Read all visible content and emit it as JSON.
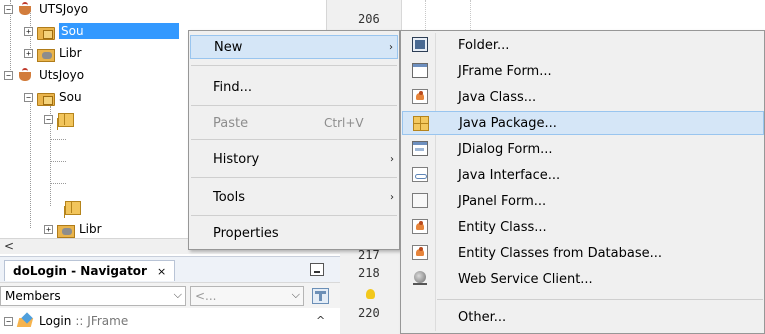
{
  "project_tree": {
    "nodes": [
      {
        "label": "UTSJoyo",
        "icon": "project-cup-icon"
      },
      {
        "label": "Sou",
        "icon": "source-packages-icon",
        "selected": true
      },
      {
        "label": "Libr",
        "icon": "libraries-icon"
      },
      {
        "label": "UtsJoyo",
        "icon": "project-cup-icon"
      },
      {
        "label": "Sou",
        "icon": "source-packages-icon"
      },
      {
        "label": "",
        "icon": "package-icon"
      },
      {
        "label": "",
        "icon": "package-icon"
      },
      {
        "label": "Libr",
        "icon": "libraries-icon"
      }
    ],
    "expander_collapsed": "+",
    "expander_expanded": "−",
    "scroll_left_arrow": "<"
  },
  "editor": {
    "line_numbers": [
      "206",
      "217",
      "218",
      "220"
    ]
  },
  "navigator": {
    "tab_title": "doLogin - Navigator",
    "tab_close": "×",
    "members_label": "Members",
    "filter_placeholder": "<...",
    "dropdown_glyph": "⌵",
    "root_name": "Login",
    "root_type": ":: JFrame",
    "scroll_up_arrow": "^"
  },
  "context_menu": {
    "items": [
      {
        "label": "New",
        "submenu": true,
        "highlighted": true
      },
      {
        "label": "Find..."
      },
      {
        "label": "Paste",
        "shortcut": "Ctrl+V",
        "disabled": true
      },
      {
        "label": "History",
        "submenu": true
      },
      {
        "label": "Tools",
        "submenu": true
      },
      {
        "label": "Properties"
      }
    ],
    "submenu_arrow": "›"
  },
  "new_submenu": {
    "items": [
      {
        "label": "Folder...",
        "icon": "folder-icon"
      },
      {
        "label": "JFrame Form...",
        "icon": "jframe-form-icon"
      },
      {
        "label": "Java Class...",
        "icon": "java-class-icon"
      },
      {
        "label": "Java Package...",
        "icon": "java-package-icon",
        "highlighted": true
      },
      {
        "label": "JDialog Form...",
        "icon": "jdialog-form-icon"
      },
      {
        "label": "Java Interface...",
        "icon": "java-interface-icon"
      },
      {
        "label": "JPanel Form...",
        "icon": "jpanel-form-icon"
      },
      {
        "label": "Entity Class...",
        "icon": "entity-class-icon"
      },
      {
        "label": "Entity Classes from Database...",
        "icon": "entity-classes-db-icon"
      },
      {
        "label": "Web Service Client...",
        "icon": "web-service-client-icon"
      },
      {
        "label": "Other..."
      }
    ]
  },
  "colors": {
    "selection": "#3399ff",
    "menu_highlight": "#d5e6f7",
    "menu_background": "#f0f0f0"
  }
}
